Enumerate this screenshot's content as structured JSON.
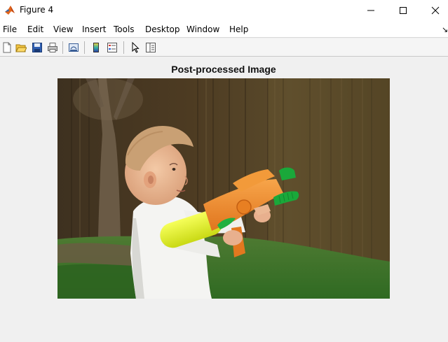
{
  "window": {
    "title": "Figure 4",
    "icon": "matlab-icon",
    "controls": [
      "minimize-icon",
      "maximize-icon",
      "close-icon"
    ]
  },
  "menu": {
    "items": [
      "File",
      "Edit",
      "View",
      "Insert",
      "Tools",
      "Desktop",
      "Window",
      "Help"
    ],
    "dock_arrow": "↘"
  },
  "toolbar": {
    "buttons": [
      "new-figure-icon",
      "open-file-icon",
      "save-icon",
      "print-icon",
      "link-plot-icon",
      "colorbar-icon",
      "legend-icon",
      "edit-plot-pointer-icon",
      "property-inspector-icon"
    ]
  },
  "figure": {
    "title": "Post-processed Image",
    "image": {
      "depicts": "photo",
      "colors": {
        "fence": "#4a3a20",
        "grass": "#3a7a2c",
        "shirt": "#f4f4f2",
        "skin": "#e9b896",
        "hair": "#c9a074",
        "gun_orange": "#f08a2a",
        "gun_yellow": "#e8f222",
        "gun_green": "#1aa83a"
      }
    }
  }
}
